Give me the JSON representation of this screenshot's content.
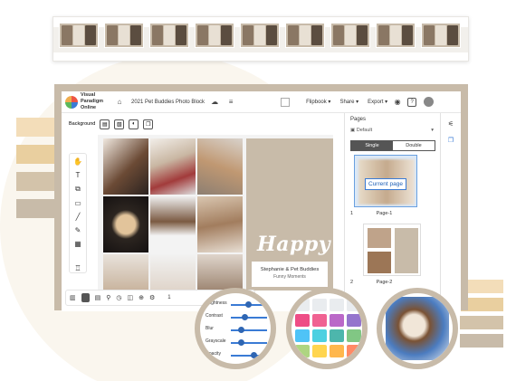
{
  "app": {
    "brand_line1": "Visual Paradigm",
    "brand_line2": "Online",
    "doc_title": "2021 Pet Buddies Photo Block"
  },
  "topbar": {
    "flipbook": "Flipbook",
    "share": "Share",
    "export": "Export",
    "flipbook_caret": "▾",
    "share_caret": "▾",
    "export_caret": "▾"
  },
  "left_toolbar": {
    "background_label": "Background"
  },
  "canvas": {
    "happy": "Happy",
    "subtitle_line1": "Stephanie & Pet Buddies",
    "subtitle_line2": "Funny Moments"
  },
  "bottom_toolbar": {
    "page_indicator": "1"
  },
  "pages_panel": {
    "title": "Pages",
    "layout_select": "Default",
    "single_label": "Single",
    "double_label": "Double",
    "tooltip": "Current page",
    "page1_number": "1",
    "page1_label": "Page-1",
    "page2_number": "2",
    "page2_label": "Page-2"
  },
  "adjust_popover": {
    "sliders": [
      {
        "label": "Brightness",
        "level": 0.6
      },
      {
        "label": "Contrast",
        "level": 0.52
      },
      {
        "label": "Blur",
        "level": 0.45
      },
      {
        "label": "Grayscale",
        "level": 0.45
      },
      {
        "label": "Opacity",
        "level": 0.75
      }
    ]
  },
  "colors": {
    "accent": "#c8bba9",
    "link_blue": "#3a7bd5",
    "palette": [
      "#e9ecef",
      "#e9ecef",
      "#e9ecef",
      "#e9ecef",
      "#ee4d86",
      "#f06292",
      "#ba68c8",
      "#9575cd",
      "#4fc3f7",
      "#4dd0e1",
      "#4db6ac",
      "#81c784",
      "#aed581",
      "#ffd54f",
      "#ffb74d",
      "#ff8a65"
    ],
    "left_swatches": [
      "#f3ddb9",
      "#e9cf9f",
      "#d3c3aa",
      "#c8bba9"
    ],
    "right_swatches": [
      "#f3ddb9",
      "#e9cf9f",
      "#d3c3aa",
      "#c8bba9"
    ]
  },
  "icons": {
    "home": "home-icon",
    "undo": "undo-icon",
    "menu": "hamburger-icon",
    "help": "help-icon",
    "settings": "settings-icon",
    "user": "user-icon"
  }
}
